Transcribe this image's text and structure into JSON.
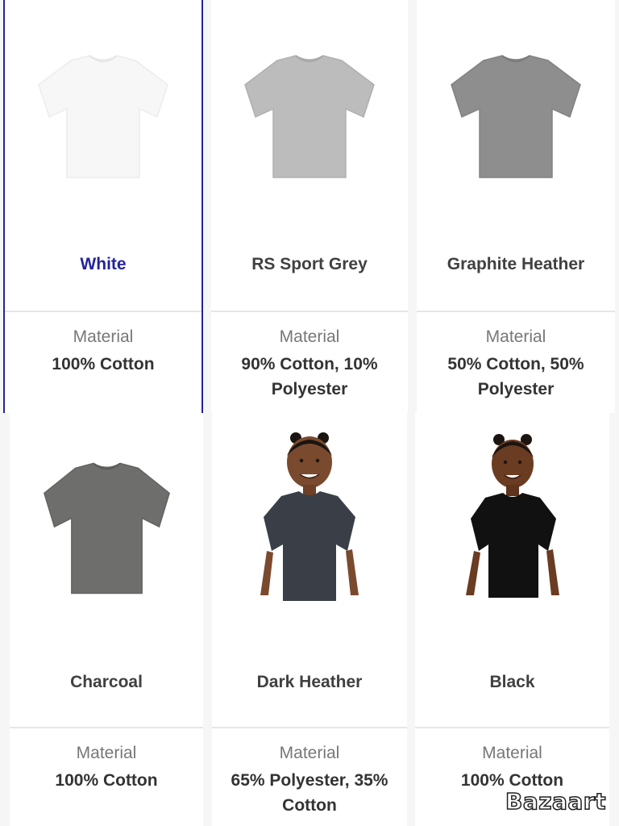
{
  "products": [
    {
      "name": "White",
      "material_label": "Material",
      "material": "100% Cotton",
      "selected": true
    },
    {
      "name": "RS Sport Grey",
      "material_label": "Material",
      "material": "90% Cotton, 10% Polyester",
      "selected": false
    },
    {
      "name": "Graphite Heather",
      "material_label": "Material",
      "material": "50% Cotton, 50% Polyester",
      "selected": false
    },
    {
      "name": "Charcoal",
      "material_label": "Material",
      "material": "100% Cotton",
      "selected": false
    },
    {
      "name": "Dark Heather",
      "material_label": "Material",
      "material": "65% Polyester, 35% Cotton",
      "selected": false
    },
    {
      "name": "Black",
      "material_label": "Material",
      "material": "100% Cotton",
      "selected": false
    }
  ],
  "colors": {
    "selected_accent": "#24249a",
    "white_shirt": "#f7f7f7",
    "sport_grey_shirt": "#bcbcbc",
    "graphite_heather_shirt": "#8e8e8e",
    "charcoal_shirt": "#6e6e6c",
    "dark_heather_shirt": "#3a3f47",
    "black_shirt": "#111111"
  },
  "watermark": "Bazaart"
}
